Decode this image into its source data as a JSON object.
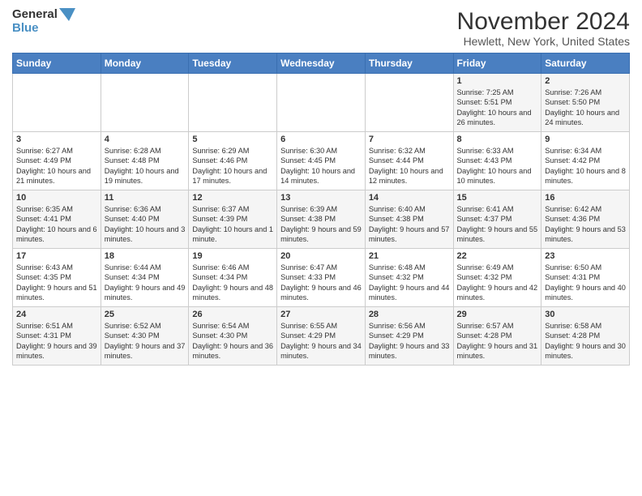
{
  "logo": {
    "line1": "General",
    "line2": "Blue"
  },
  "title": "November 2024",
  "subtitle": "Hewlett, New York, United States",
  "days_of_week": [
    "Sunday",
    "Monday",
    "Tuesday",
    "Wednesday",
    "Thursday",
    "Friday",
    "Saturday"
  ],
  "weeks": [
    [
      {
        "day": "",
        "info": ""
      },
      {
        "day": "",
        "info": ""
      },
      {
        "day": "",
        "info": ""
      },
      {
        "day": "",
        "info": ""
      },
      {
        "day": "",
        "info": ""
      },
      {
        "day": "1",
        "info": "Sunrise: 7:25 AM\nSunset: 5:51 PM\nDaylight: 10 hours and 26 minutes."
      },
      {
        "day": "2",
        "info": "Sunrise: 7:26 AM\nSunset: 5:50 PM\nDaylight: 10 hours and 24 minutes."
      }
    ],
    [
      {
        "day": "3",
        "info": "Sunrise: 6:27 AM\nSunset: 4:49 PM\nDaylight: 10 hours and 21 minutes."
      },
      {
        "day": "4",
        "info": "Sunrise: 6:28 AM\nSunset: 4:48 PM\nDaylight: 10 hours and 19 minutes."
      },
      {
        "day": "5",
        "info": "Sunrise: 6:29 AM\nSunset: 4:46 PM\nDaylight: 10 hours and 17 minutes."
      },
      {
        "day": "6",
        "info": "Sunrise: 6:30 AM\nSunset: 4:45 PM\nDaylight: 10 hours and 14 minutes."
      },
      {
        "day": "7",
        "info": "Sunrise: 6:32 AM\nSunset: 4:44 PM\nDaylight: 10 hours and 12 minutes."
      },
      {
        "day": "8",
        "info": "Sunrise: 6:33 AM\nSunset: 4:43 PM\nDaylight: 10 hours and 10 minutes."
      },
      {
        "day": "9",
        "info": "Sunrise: 6:34 AM\nSunset: 4:42 PM\nDaylight: 10 hours and 8 minutes."
      }
    ],
    [
      {
        "day": "10",
        "info": "Sunrise: 6:35 AM\nSunset: 4:41 PM\nDaylight: 10 hours and 6 minutes."
      },
      {
        "day": "11",
        "info": "Sunrise: 6:36 AM\nSunset: 4:40 PM\nDaylight: 10 hours and 3 minutes."
      },
      {
        "day": "12",
        "info": "Sunrise: 6:37 AM\nSunset: 4:39 PM\nDaylight: 10 hours and 1 minute."
      },
      {
        "day": "13",
        "info": "Sunrise: 6:39 AM\nSunset: 4:38 PM\nDaylight: 9 hours and 59 minutes."
      },
      {
        "day": "14",
        "info": "Sunrise: 6:40 AM\nSunset: 4:38 PM\nDaylight: 9 hours and 57 minutes."
      },
      {
        "day": "15",
        "info": "Sunrise: 6:41 AM\nSunset: 4:37 PM\nDaylight: 9 hours and 55 minutes."
      },
      {
        "day": "16",
        "info": "Sunrise: 6:42 AM\nSunset: 4:36 PM\nDaylight: 9 hours and 53 minutes."
      }
    ],
    [
      {
        "day": "17",
        "info": "Sunrise: 6:43 AM\nSunset: 4:35 PM\nDaylight: 9 hours and 51 minutes."
      },
      {
        "day": "18",
        "info": "Sunrise: 6:44 AM\nSunset: 4:34 PM\nDaylight: 9 hours and 49 minutes."
      },
      {
        "day": "19",
        "info": "Sunrise: 6:46 AM\nSunset: 4:34 PM\nDaylight: 9 hours and 48 minutes."
      },
      {
        "day": "20",
        "info": "Sunrise: 6:47 AM\nSunset: 4:33 PM\nDaylight: 9 hours and 46 minutes."
      },
      {
        "day": "21",
        "info": "Sunrise: 6:48 AM\nSunset: 4:32 PM\nDaylight: 9 hours and 44 minutes."
      },
      {
        "day": "22",
        "info": "Sunrise: 6:49 AM\nSunset: 4:32 PM\nDaylight: 9 hours and 42 minutes."
      },
      {
        "day": "23",
        "info": "Sunrise: 6:50 AM\nSunset: 4:31 PM\nDaylight: 9 hours and 40 minutes."
      }
    ],
    [
      {
        "day": "24",
        "info": "Sunrise: 6:51 AM\nSunset: 4:31 PM\nDaylight: 9 hours and 39 minutes."
      },
      {
        "day": "25",
        "info": "Sunrise: 6:52 AM\nSunset: 4:30 PM\nDaylight: 9 hours and 37 minutes."
      },
      {
        "day": "26",
        "info": "Sunrise: 6:54 AM\nSunset: 4:30 PM\nDaylight: 9 hours and 36 minutes."
      },
      {
        "day": "27",
        "info": "Sunrise: 6:55 AM\nSunset: 4:29 PM\nDaylight: 9 hours and 34 minutes."
      },
      {
        "day": "28",
        "info": "Sunrise: 6:56 AM\nSunset: 4:29 PM\nDaylight: 9 hours and 33 minutes."
      },
      {
        "day": "29",
        "info": "Sunrise: 6:57 AM\nSunset: 4:28 PM\nDaylight: 9 hours and 31 minutes."
      },
      {
        "day": "30",
        "info": "Sunrise: 6:58 AM\nSunset: 4:28 PM\nDaylight: 9 hours and 30 minutes."
      }
    ]
  ]
}
